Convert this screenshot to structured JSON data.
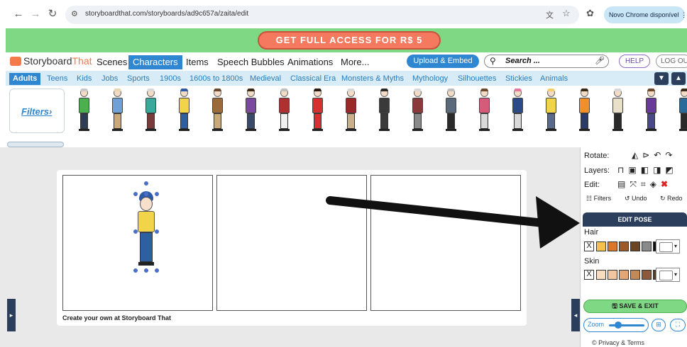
{
  "browser": {
    "url": "storyboardthat.com/storyboards/ad9c657a/zaita/edit",
    "update_badge": "Novo Chrome disponível"
  },
  "promo": {
    "label": "GET FULL ACCESS FOR R$ 5"
  },
  "header": {
    "logo_a": "Storyboard",
    "logo_b": "That",
    "tabs": [
      "Scenes",
      "Characters",
      "Items",
      "Speech Bubbles",
      "Animations",
      "More..."
    ],
    "active_tab": "Characters",
    "upload_label": "Upload & Embed",
    "search_placeholder": "Search ...",
    "help_label": "HELP",
    "logout_label": "LOG OUT"
  },
  "categories": [
    "Adults",
    "Teens",
    "Kids",
    "Jobs",
    "Sports",
    "1900s",
    "1600s to 1800s",
    "Medieval",
    "Classical Era",
    "Monsters & Myths",
    "Mythology",
    "Silhouettes",
    "Stickies",
    "Animals"
  ],
  "active_category": "Adults",
  "filters_label": "Filters",
  "characters": [
    {
      "hair": "#c9c9c9",
      "top": "#4caf50",
      "bottom": "#2d3b55"
    },
    {
      "hair": "#e8d6b0",
      "top": "#6fa0d8",
      "bottom": "#c9a97a"
    },
    {
      "hair": "#d9d9d9",
      "top": "#3aa89a",
      "bottom": "#7a3b3b"
    },
    {
      "hair": "#2f5aa8",
      "top": "#f2d44a",
      "bottom": "#2e5fa0"
    },
    {
      "hair": "#6b4a2e",
      "top": "#9a6a3a",
      "bottom": "#c9a97a"
    },
    {
      "hair": "#3a2a1a",
      "top": "#7a4aa0",
      "bottom": "#3a4a6a"
    },
    {
      "hair": "#bfbfbf",
      "top": "#b03030",
      "bottom": "#f0f0f0"
    },
    {
      "hair": "#2a1a10",
      "top": "#d83030",
      "bottom": "#d83030"
    },
    {
      "hair": "#d9d9d9",
      "top": "#9a2a2a",
      "bottom": "#c9b08a"
    },
    {
      "hair": "#2a2a2a",
      "top": "#3a3a3a",
      "bottom": "#3a3a3a"
    },
    {
      "hair": "#d9d9d9",
      "top": "#8a3a3a",
      "bottom": "#8a8a8a"
    },
    {
      "hair": "#bfbfbf",
      "top": "#5a6a7a",
      "bottom": "#2a2a2a"
    },
    {
      "hair": "#6b4a2e",
      "top": "#d65a7a",
      "bottom": "#d9d9d9"
    },
    {
      "hair": "#e07aa0",
      "top": "#2a4a8a",
      "bottom": "#d9d9d9"
    },
    {
      "hair": "#f0d070",
      "top": "#f2d44a",
      "bottom": "#5a6a8a"
    },
    {
      "hair": "#3a2a1a",
      "top": "#f0902a",
      "bottom": "#2a3a6a"
    },
    {
      "hair": "#d9d9d9",
      "top": "#e8e0c8",
      "bottom": "#2a2a2a"
    },
    {
      "hair": "#6b4a2e",
      "top": "#6a3a9a",
      "bottom": "#4a4a8a"
    },
    {
      "hair": "#3a2a1a",
      "top": "#2a6a9a",
      "bottom": "#2a2a2a"
    }
  ],
  "storyboard": {
    "credit": "Create your own at Storyboard That"
  },
  "panel": {
    "rotate_label": "Rotate:",
    "layers_label": "Layers:",
    "edit_label": "Edit:",
    "filters_btn": "Filters",
    "undo_btn": "Undo",
    "redo_btn": "Redo",
    "edit_pose": "EDIT POSE",
    "hair_label": "Hair",
    "hair_colors": [
      "#f4c24a",
      "#d9782a",
      "#9a5a2a",
      "#6b4424",
      "#8a8a8a",
      "#111111"
    ],
    "skin_label": "Skin",
    "skin_colors": [
      "#f8dcc0",
      "#f2c6a0",
      "#e0a878",
      "#c08a5a",
      "#8a5a3a",
      "#5a3a22"
    ],
    "x_label": "X",
    "save_exit": "SAVE & EXIT",
    "zoom_label": "Zoom",
    "privacy": "© Privacy & Terms"
  }
}
